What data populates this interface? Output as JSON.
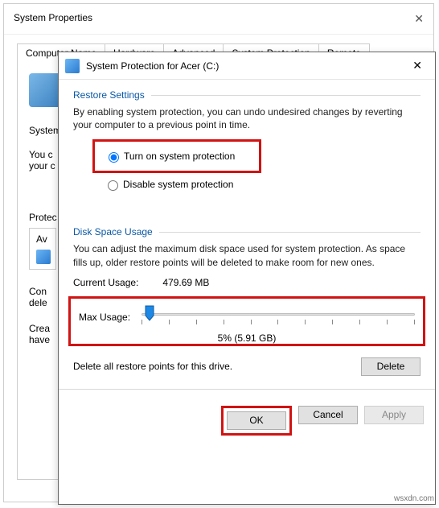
{
  "bg": {
    "title": "System Properties",
    "tabs": [
      "Computer Name",
      "Hardware",
      "Advanced",
      "System Protection",
      "Remote"
    ],
    "line1": "System",
    "line2": "You c",
    "line3": "your c",
    "protect_label": "Protec",
    "av_label": "Av",
    "configure_line1": "Con",
    "configure_line2": "dele",
    "create_line1": "Crea",
    "create_line2": "have"
  },
  "dialog": {
    "title": "System Protection for Acer (C:)",
    "restore_settings_label": "Restore Settings",
    "restore_desc": "By enabling system protection, you can undo undesired changes by reverting your computer to a previous point in time.",
    "radio_on": "Turn on system protection",
    "radio_off": "Disable system protection",
    "disk_usage_label": "Disk Space Usage",
    "disk_desc": "You can adjust the maximum disk space used for system protection. As space fills up, older restore points will be deleted to make room for new ones.",
    "current_usage_label": "Current Usage:",
    "current_usage_value": "479.69 MB",
    "max_usage_label": "Max Usage:",
    "max_usage_readout": "5% (5.91 GB)",
    "delete_desc": "Delete all restore points for this drive.",
    "buttons": {
      "delete": "Delete",
      "ok": "OK",
      "cancel": "Cancel",
      "apply": "Apply"
    }
  },
  "watermark": "wsxdn.com"
}
